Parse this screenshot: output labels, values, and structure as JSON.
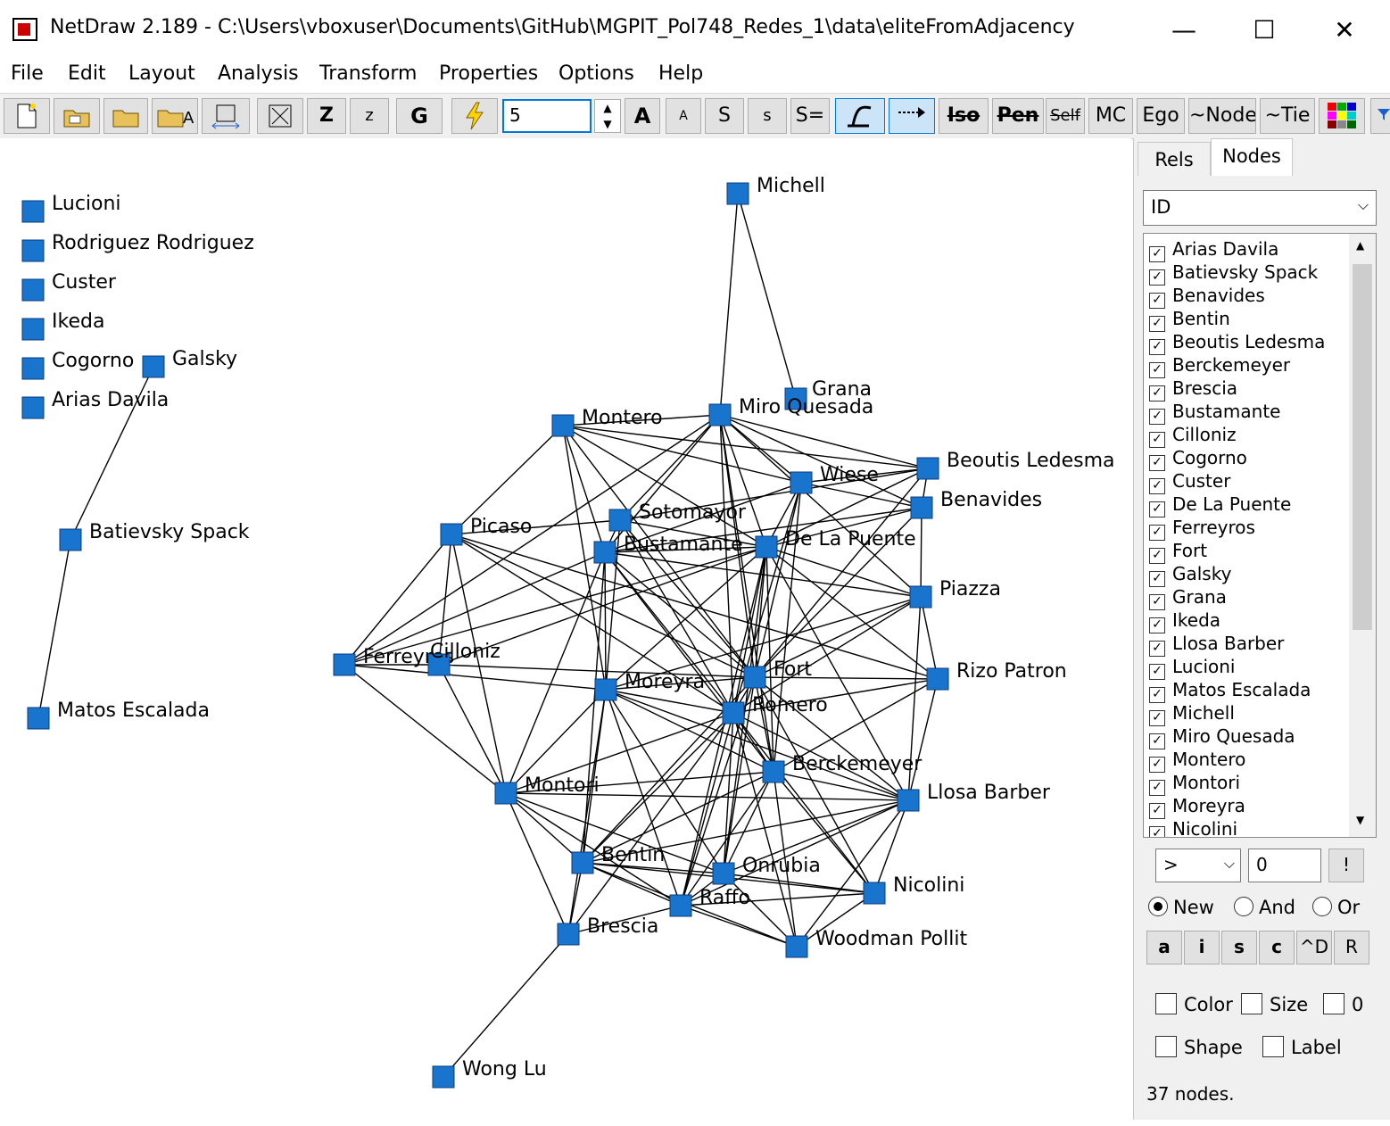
{
  "window": {
    "title": "NetDraw 2.189 - C:\\Users\\vboxuser\\Documents\\GitHub\\MGPIT_Pol748_Redes_1\\data\\eliteFromAdjacency",
    "minimize": "—",
    "maximize": "☐",
    "close": "✕"
  },
  "menu": [
    "File",
    "Edit",
    "Layout",
    "Analysis",
    "Transform",
    "Properties",
    "Options",
    "Help"
  ],
  "toolbar": {
    "buttons": [
      "Z",
      "z",
      "G",
      "A",
      "A",
      "S",
      "s",
      "S=",
      "Iso",
      "Pen",
      "Self",
      "MC",
      "Ego",
      "~Node",
      "~Tie"
    ],
    "input_value": "5"
  },
  "graph": {
    "node_color": "#1874cd",
    "nodes": [
      {
        "id": "lucioni",
        "label": "Lucioni"
      },
      {
        "id": "rodriguez",
        "label": "Rodriguez Rodriguez"
      },
      {
        "id": "custer",
        "label": "Custer"
      },
      {
        "id": "ikeda",
        "label": "Ikeda"
      },
      {
        "id": "cogorno",
        "label": "Cogorno"
      },
      {
        "id": "galsky",
        "label": "Galsky"
      },
      {
        "id": "arias",
        "label": "Arias Davila"
      },
      {
        "id": "batievsky",
        "label": "Batievsky Spack"
      },
      {
        "id": "matos",
        "label": "Matos Escalada"
      },
      {
        "id": "michell",
        "label": "Michell"
      },
      {
        "id": "grana",
        "label": "Grana"
      },
      {
        "id": "montero",
        "label": "Montero"
      },
      {
        "id": "miro",
        "label": "Miro Quesada"
      },
      {
        "id": "wiese",
        "label": "Wiese"
      },
      {
        "id": "beoutis",
        "label": "Beoutis Ledesma"
      },
      {
        "id": "benavides",
        "label": "Benavides"
      },
      {
        "id": "picaso",
        "label": "Picaso"
      },
      {
        "id": "sotomayor",
        "label": "Sotomayor"
      },
      {
        "id": "bustamante",
        "label": "Bustamante"
      },
      {
        "id": "delapuente",
        "label": "De La Puente"
      },
      {
        "id": "piazza",
        "label": "Piazza"
      },
      {
        "id": "ferreyros",
        "label": "Ferreyros"
      },
      {
        "id": "cilloniz",
        "label": "Cilloniz"
      },
      {
        "id": "moreyra",
        "label": "Moreyra"
      },
      {
        "id": "fort",
        "label": "Fort"
      },
      {
        "id": "rizo",
        "label": "Rizo Patron"
      },
      {
        "id": "romero",
        "label": "Romero"
      },
      {
        "id": "berckemeyer",
        "label": "Berckemeyer"
      },
      {
        "id": "montori",
        "label": "Montori"
      },
      {
        "id": "llosa",
        "label": "Llosa Barber"
      },
      {
        "id": "bentin",
        "label": "Bentin"
      },
      {
        "id": "onrubia",
        "label": "Onrubia"
      },
      {
        "id": "raffo",
        "label": "Raffo"
      },
      {
        "id": "nicolini",
        "label": "Nicolini"
      },
      {
        "id": "brescia",
        "label": "Brescia"
      },
      {
        "id": "woodman",
        "label": "Woodman Pollit"
      },
      {
        "id": "wonglu",
        "label": "Wong Lu"
      }
    ],
    "edges": [
      [
        "galsky",
        "batievsky"
      ],
      [
        "batievsky",
        "matos"
      ],
      [
        "michell",
        "miro"
      ],
      [
        "michell",
        "grana"
      ],
      [
        "montero",
        "miro"
      ],
      [
        "montero",
        "picaso"
      ],
      [
        "montero",
        "bustamante"
      ],
      [
        "montero",
        "moreyra"
      ],
      [
        "montero",
        "beoutis"
      ],
      [
        "montero",
        "wiese"
      ],
      [
        "montero",
        "delapuente"
      ],
      [
        "montero",
        "fort"
      ],
      [
        "miro",
        "wiese"
      ],
      [
        "miro",
        "beoutis"
      ],
      [
        "miro",
        "benavides"
      ],
      [
        "miro",
        "delapuente"
      ],
      [
        "miro",
        "fort"
      ],
      [
        "miro",
        "romero"
      ],
      [
        "miro",
        "bustamante"
      ],
      [
        "miro",
        "sotomayor"
      ],
      [
        "miro",
        "piazza"
      ],
      [
        "miro",
        "berckemeyer"
      ],
      [
        "miro",
        "ferreyros"
      ],
      [
        "wiese",
        "beoutis"
      ],
      [
        "wiese",
        "benavides"
      ],
      [
        "wiese",
        "delapuente"
      ],
      [
        "wiese",
        "fort"
      ],
      [
        "wiese",
        "romero"
      ],
      [
        "wiese",
        "bustamante"
      ],
      [
        "wiese",
        "berckemeyer"
      ],
      [
        "beoutis",
        "benavides"
      ],
      [
        "beoutis",
        "delapuente"
      ],
      [
        "beoutis",
        "sotomayor"
      ],
      [
        "beoutis",
        "fort"
      ],
      [
        "benavides",
        "piazza"
      ],
      [
        "benavides",
        "delapuente"
      ],
      [
        "benavides",
        "fort"
      ],
      [
        "benavides",
        "bustamante"
      ],
      [
        "picaso",
        "sotomayor"
      ],
      [
        "picaso",
        "ferreyros"
      ],
      [
        "picaso",
        "cilloniz"
      ],
      [
        "picaso",
        "fort"
      ],
      [
        "picaso",
        "rizo"
      ],
      [
        "picaso",
        "romero"
      ],
      [
        "picaso",
        "montori"
      ],
      [
        "sotomayor",
        "bustamante"
      ],
      [
        "sotomayor",
        "delapuente"
      ],
      [
        "sotomayor",
        "fort"
      ],
      [
        "sotomayor",
        "romero"
      ],
      [
        "sotomayor",
        "moreyra"
      ],
      [
        "bustamante",
        "delapuente"
      ],
      [
        "bustamante",
        "moreyra"
      ],
      [
        "bustamante",
        "fort"
      ],
      [
        "bustamante",
        "romero"
      ],
      [
        "bustamante",
        "berckemeyer"
      ],
      [
        "bustamante",
        "piazza"
      ],
      [
        "bustamante",
        "montori"
      ],
      [
        "bustamante",
        "bentin"
      ],
      [
        "delapuente",
        "piazza"
      ],
      [
        "delapuente",
        "fort"
      ],
      [
        "delapuente",
        "romero"
      ],
      [
        "delapuente",
        "rizo"
      ],
      [
        "delapuente",
        "moreyra"
      ],
      [
        "delapuente",
        "berckemeyer"
      ],
      [
        "delapuente",
        "llosa"
      ],
      [
        "delapuente",
        "raffo"
      ],
      [
        "delapuente",
        "onrubia"
      ],
      [
        "piazza",
        "rizo"
      ],
      [
        "piazza",
        "fort"
      ],
      [
        "piazza",
        "romero"
      ],
      [
        "piazza",
        "llosa"
      ],
      [
        "piazza",
        "moreyra"
      ],
      [
        "ferreyros",
        "cilloniz"
      ],
      [
        "ferreyros",
        "montori"
      ],
      [
        "ferreyros",
        "moreyra"
      ],
      [
        "ferreyros",
        "bustamante"
      ],
      [
        "ferreyros",
        "delapuente"
      ],
      [
        "cilloniz",
        "fort"
      ],
      [
        "cilloniz",
        "montori"
      ],
      [
        "cilloniz",
        "delapuente"
      ],
      [
        "moreyra",
        "fort"
      ],
      [
        "moreyra",
        "romero"
      ],
      [
        "moreyra",
        "berckemeyer"
      ],
      [
        "moreyra",
        "montori"
      ],
      [
        "moreyra",
        "bentin"
      ],
      [
        "moreyra",
        "raffo"
      ],
      [
        "moreyra",
        "onrubia"
      ],
      [
        "moreyra",
        "llosa"
      ],
      [
        "moreyra",
        "brescia"
      ],
      [
        "fort",
        "rizo"
      ],
      [
        "fort",
        "romero"
      ],
      [
        "fort",
        "berckemeyer"
      ],
      [
        "fort",
        "llosa"
      ],
      [
        "fort",
        "onrubia"
      ],
      [
        "fort",
        "raffo"
      ],
      [
        "fort",
        "bentin"
      ],
      [
        "fort",
        "nicolini"
      ],
      [
        "rizo",
        "romero"
      ],
      [
        "rizo",
        "llosa"
      ],
      [
        "rizo",
        "berckemeyer"
      ],
      [
        "romero",
        "berckemeyer"
      ],
      [
        "romero",
        "montori"
      ],
      [
        "romero",
        "llosa"
      ],
      [
        "romero",
        "bentin"
      ],
      [
        "romero",
        "onrubia"
      ],
      [
        "romero",
        "raffo"
      ],
      [
        "romero",
        "woodman"
      ],
      [
        "romero",
        "brescia"
      ],
      [
        "romero",
        "nicolini"
      ],
      [
        "berckemeyer",
        "llosa"
      ],
      [
        "berckemeyer",
        "montori"
      ],
      [
        "berckemeyer",
        "onrubia"
      ],
      [
        "berckemeyer",
        "raffo"
      ],
      [
        "berckemeyer",
        "woodman"
      ],
      [
        "berckemeyer",
        "nicolini"
      ],
      [
        "berckemeyer",
        "bentin"
      ],
      [
        "montori",
        "bentin"
      ],
      [
        "montori",
        "raffo"
      ],
      [
        "montori",
        "brescia"
      ],
      [
        "montori",
        "onrubia"
      ],
      [
        "montori",
        "llosa"
      ],
      [
        "llosa",
        "bentin"
      ],
      [
        "llosa",
        "onrubia"
      ],
      [
        "llosa",
        "raffo"
      ],
      [
        "llosa",
        "nicolini"
      ],
      [
        "llosa",
        "woodman"
      ],
      [
        "bentin",
        "onrubia"
      ],
      [
        "bentin",
        "raffo"
      ],
      [
        "bentin",
        "brescia"
      ],
      [
        "bentin",
        "woodman"
      ],
      [
        "bentin",
        "nicolini"
      ],
      [
        "onrubia",
        "raffo"
      ],
      [
        "onrubia",
        "nicolini"
      ],
      [
        "onrubia",
        "woodman"
      ],
      [
        "raffo",
        "woodman"
      ],
      [
        "raffo",
        "nicolini"
      ],
      [
        "raffo",
        "brescia"
      ],
      [
        "nicolini",
        "woodman"
      ],
      [
        "brescia",
        "wonglu"
      ]
    ]
  },
  "sidebar": {
    "tabs": [
      "Rels",
      "Nodes"
    ],
    "attribute_select": "ID",
    "node_list": [
      "Arias Davila",
      "Batievsky Spack",
      "Benavides",
      "Bentin",
      "Beoutis Ledesma",
      "Berckemeyer",
      "Brescia",
      "Bustamante",
      "Cilloniz",
      "Cogorno",
      "Custer",
      "De La Puente",
      "Ferreyros",
      "Fort",
      "Galsky",
      "Grana",
      "Ikeda",
      "Llosa Barber",
      "Lucioni",
      "Matos Escalada",
      "Michell",
      "Miro Quesada",
      "Montero",
      "Montori",
      "Moreyra",
      "Nicolini"
    ],
    "operator": ">",
    "threshold": "0",
    "apply_button": "!",
    "radios": [
      "New",
      "And",
      "Or"
    ],
    "small_buttons": [
      "a",
      "i",
      "s",
      "c",
      "^D",
      "R"
    ],
    "checkboxes": [
      "Color",
      "Size",
      "0",
      "Shape",
      "Label"
    ],
    "status": "37 nodes."
  }
}
